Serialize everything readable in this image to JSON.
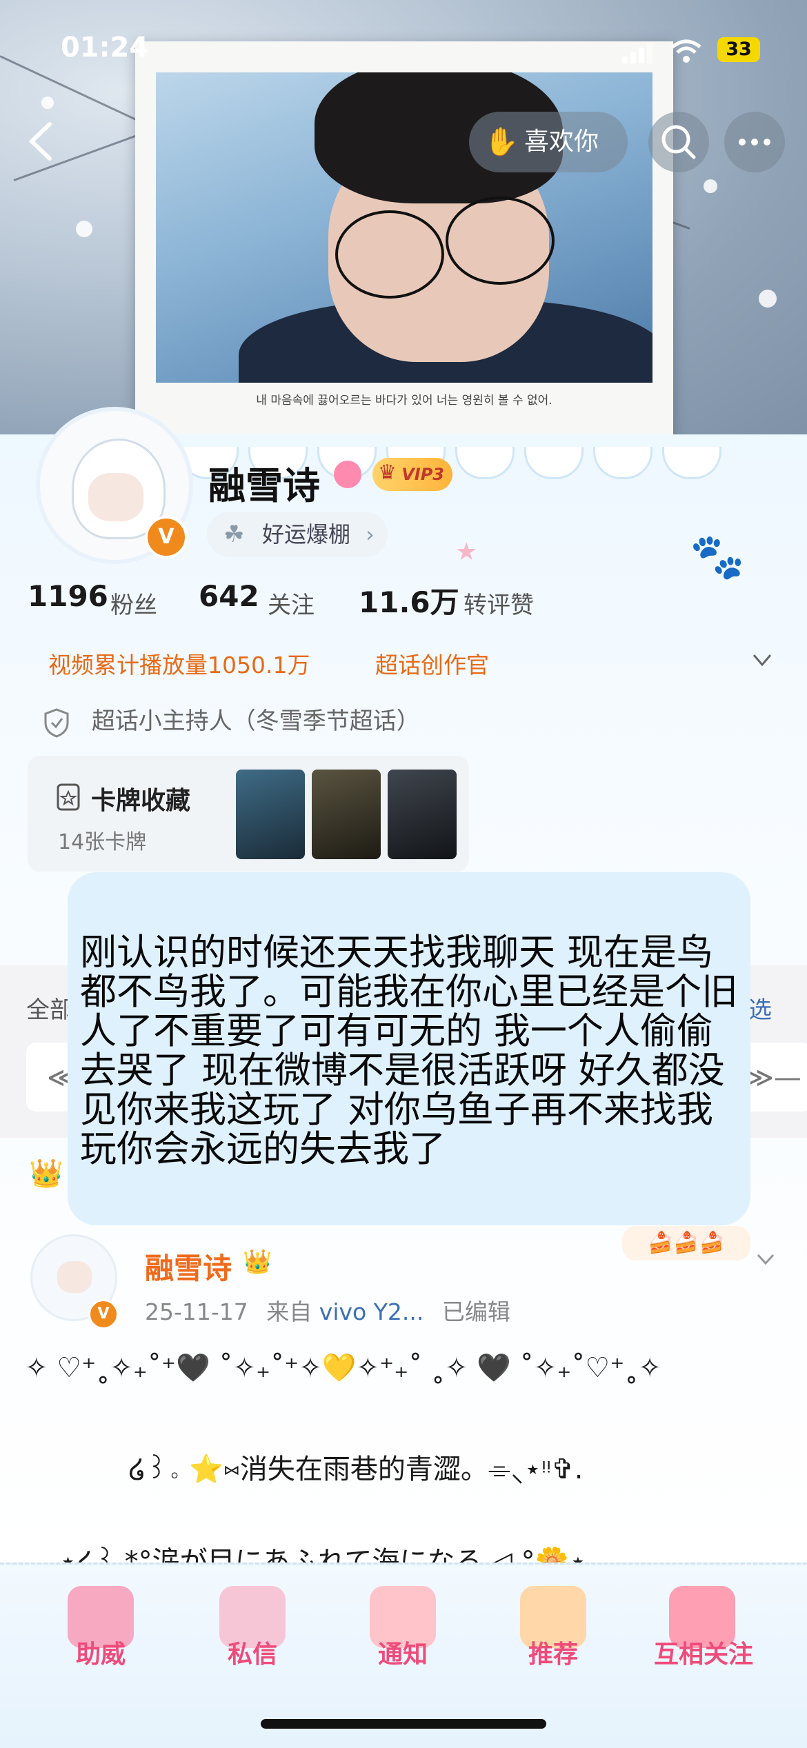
{
  "status_bar": {
    "time": "01:24",
    "battery": "33"
  },
  "nav": {
    "like_label": "喜欢你"
  },
  "cover": {
    "caption": "내 마음속에 끓어오르는 바다가 있어 너는 영원히 볼 수 없어."
  },
  "profile": {
    "name": "融雪诗",
    "vip_label": "VIP3",
    "verify_mark": "V",
    "status": "好运爆棚",
    "stats": [
      {
        "num": "1196",
        "label": "粉丝"
      },
      {
        "num": "642",
        "label": "关注"
      },
      {
        "num": "11.6万",
        "label": "转评赞"
      }
    ],
    "tags": [
      "视频累计播放量1050.1万",
      "超话创作官"
    ],
    "host_text": "超话小主持人（冬雪季节超话）",
    "cards": {
      "title": "卡牌收藏",
      "count": "14张卡牌"
    }
  },
  "tabs_bg": {
    "all_label": "全部",
    "filter_label": "选"
  },
  "bubble": {
    "text": "刚认识的时候还天天找我聊天 现在是鸟都不鸟我了。可能我在你心里已经是个旧人了不重要了可有可无的 我一个人偷偷去哭了 现在微博不是很活跃呀 好久都没见你来我这玩了 对你乌鱼子再不来找我玩你会永远的失去我了"
  },
  "post": {
    "author": "融雪诗",
    "date": "25-11-17",
    "source_prefix": "来自",
    "device": "vivo Y2...",
    "edited": "已编辑",
    "lines": [
      "✧ ♡⁺˳✧₊˚⁺🖤 ˚✧₊˚⁺✧💛✧⁺₊˚ ˳✧ 🖤 ˚✧₊˚♡⁺˳✧",
      "໒꒱。⭐️⑅消失在雨巷的青澀。⌯⸜⋆ᵎᵎ✞.",
      "⋆໒꒱ *°涙が目にあふれて海になる ◁ °🌼⋆"
    ]
  },
  "tabbar": {
    "items": [
      {
        "label": "助威",
        "color": "#f7a9c2"
      },
      {
        "label": "私信",
        "color": "#f7c6d6"
      },
      {
        "label": "通知",
        "color": "#ffc4c9"
      },
      {
        "label": "推荐",
        "color": "#ffd7a8"
      },
      {
        "label": "互相关注",
        "color": "#ff9fb3"
      }
    ]
  }
}
